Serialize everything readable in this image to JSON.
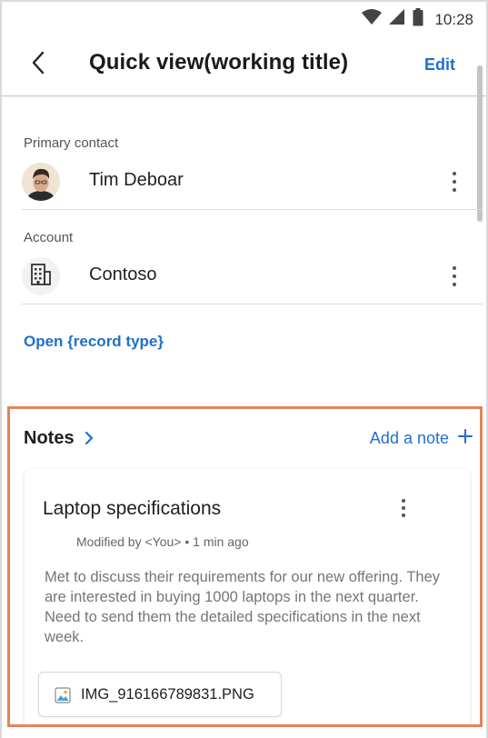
{
  "status_bar": {
    "time": "10:28",
    "icons": [
      "wifi-icon",
      "cellular-icon",
      "battery-icon"
    ]
  },
  "header": {
    "title": "Quick view(working title)",
    "edit_label": "Edit",
    "back_icon": "chevron-left-icon"
  },
  "primary_contact": {
    "label": "Primary contact",
    "name": "Tim Deboar"
  },
  "account": {
    "label": "Account",
    "name": "Contoso",
    "icon": "building-icon"
  },
  "open_record_link": "Open {record type}",
  "notes": {
    "title": "Notes",
    "add_note_label": "Add a note",
    "items": [
      {
        "title": "Laptop specifications",
        "meta": "Modified by <You> • 1 min ago",
        "body": "Met to discuss their requirements for our new offering. They are interested in buying 1000 laptops in the next quarter. Need to send them the detailed specifications in the next week.",
        "attachment": "IMG_916166789831.PNG"
      }
    ]
  },
  "colors": {
    "accent": "#1f6fd1",
    "highlight_border": "#e4845b"
  }
}
